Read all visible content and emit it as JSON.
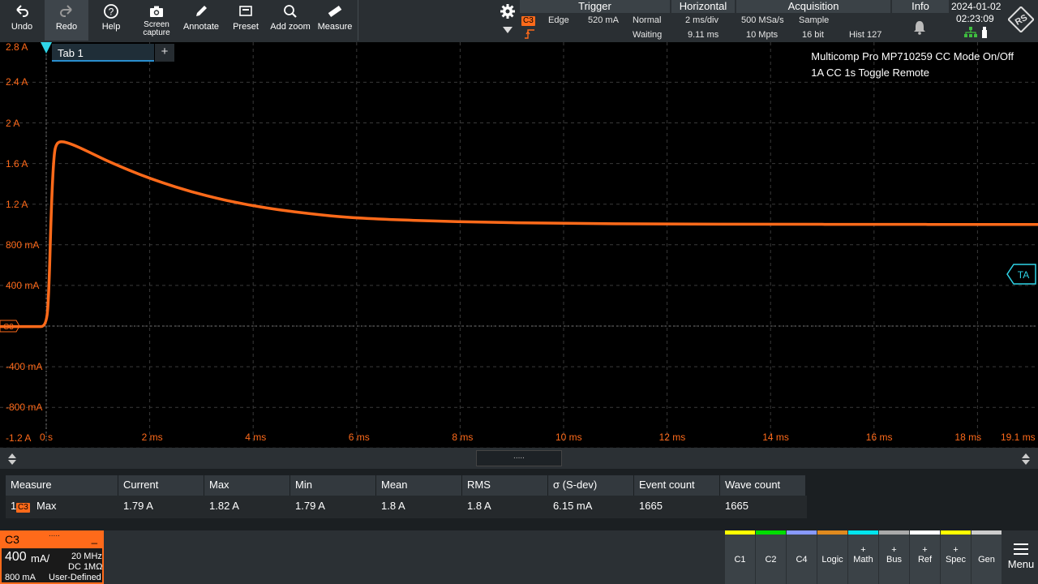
{
  "toolbar": {
    "buttons": [
      {
        "label": "Undo",
        "icon": "undo-icon"
      },
      {
        "label": "Redo",
        "icon": "redo-icon"
      },
      {
        "label": "Help",
        "icon": "help-icon"
      },
      {
        "label": "Screen capture",
        "icon": "camera-icon"
      },
      {
        "label": "Annotate",
        "icon": "pencil-icon"
      },
      {
        "label": "Preset",
        "icon": "preset-icon"
      },
      {
        "label": "Add zoom",
        "icon": "zoom-icon"
      },
      {
        "label": "Measure",
        "icon": "ruler-icon"
      }
    ],
    "screen_capture_line1": "Screen",
    "screen_capture_line2": "capture"
  },
  "trigger": {
    "title": "Trigger",
    "source": "C3",
    "type": "Edge",
    "level": "520 mA",
    "mode": "Normal",
    "state": "Waiting"
  },
  "horizontal": {
    "title": "Horizontal",
    "scale": "2 ms/div",
    "position": "9.11 ms"
  },
  "acquisition": {
    "title": "Acquisition",
    "sample_rate": "500 MSa/s",
    "mode": "Sample",
    "record_length": "10 Mpts",
    "resolution": "16 bit",
    "hist": "Hist 127"
  },
  "info": {
    "title": "Info",
    "date": "2024-01-02",
    "time": "02:23:09"
  },
  "tabs": {
    "tab1": "Tab 1",
    "add": "+"
  },
  "annotation": {
    "line1": "Multicomp Pro MP710259 CC Mode On/Off",
    "line2": "1A CC 1s Toggle Remote"
  },
  "chart_data": {
    "type": "line",
    "series": [
      {
        "name": "C3",
        "color": "#ff6a1a",
        "x_ms": [
          -0.2,
          0,
          0.05,
          0.1,
          0.15,
          0.2,
          0.3,
          0.5,
          0.8,
          1.2,
          2.0,
          3.0,
          4.0,
          5.0,
          6.0,
          8.0,
          10.0,
          12.0,
          14.0,
          16.0,
          18.0,
          19.1
        ],
        "y_A": [
          -0.005,
          -0.005,
          0.3,
          1.2,
          1.7,
          1.8,
          1.82,
          1.79,
          1.72,
          1.62,
          1.45,
          1.29,
          1.18,
          1.11,
          1.06,
          1.025,
          1.01,
          1.004,
          1.002,
          1.001,
          1.0,
          1.0
        ]
      }
    ],
    "y_ticks": [
      "2.8 A",
      "2.4 A",
      "2 A",
      "1.6 A",
      "1.2 A",
      "800 mA",
      "400 mA",
      "",
      "-400 mA",
      "-800 mA",
      "-1.2 A"
    ],
    "y_tick_values": [
      2.8,
      2.4,
      2.0,
      1.6,
      1.2,
      0.8,
      0.4,
      0,
      -0.4,
      -0.8,
      -1.2
    ],
    "x_ticks": [
      "0 s",
      "2 ms",
      "4 ms",
      "6 ms",
      "8 ms",
      "10 ms",
      "12 ms",
      "14 ms",
      "16 ms",
      "18 ms",
      "19.1 ms"
    ],
    "x_tick_values": [
      0,
      2,
      4,
      6,
      8,
      10,
      12,
      14,
      16,
      18,
      19.1
    ],
    "xlim_ms": [
      -0.9,
      19.1
    ],
    "ylim_A": [
      -1.2,
      2.8
    ],
    "grid": true,
    "ground_marker": "C3",
    "trigger_marker": "TA"
  },
  "measurements": {
    "headers": [
      "Measure",
      "Current",
      "Max",
      "Min",
      "Mean",
      "RMS",
      "σ (S-dev)",
      "Event count",
      "Wave count"
    ],
    "rows": [
      {
        "index": "1",
        "source": "C3",
        "name": "Max",
        "current": "1.79 A",
        "max": "1.82 A",
        "min": "1.79 A",
        "mean": "1.8 A",
        "rms": "1.8 A",
        "sdev": "6.15 mA",
        "event_count": "1665",
        "wave_count": "1665"
      }
    ]
  },
  "channel_box": {
    "name": "C3",
    "scale": "400",
    "unit": "mA/",
    "bandwidth": "20 MHz",
    "coupling": "DC 1MΩ",
    "offset": "800 mA",
    "probe": "User-Defined"
  },
  "bottom_buttons": [
    {
      "label": "C1",
      "color": "#ffff00",
      "plus": ""
    },
    {
      "label": "C2",
      "color": "#00dd00",
      "plus": ""
    },
    {
      "label": "C4",
      "color": "#8899ff",
      "plus": ""
    },
    {
      "label": "Logic",
      "color": "#e08a1e",
      "plus": ""
    },
    {
      "label": "Math",
      "color": "#00e5ee",
      "plus": "+"
    },
    {
      "label": "Bus",
      "color": "#aaaaaa",
      "plus": "+"
    },
    {
      "label": "Ref",
      "color": "#ffffff",
      "plus": "+"
    },
    {
      "label": "Spec",
      "color": "#ffff00",
      "plus": "+"
    },
    {
      "label": "Gen",
      "color": "#cccccc",
      "plus": ""
    }
  ],
  "menu_label": "Menu",
  "colors": {
    "channel": "#ff6a1a",
    "grid": "#3a3a3a",
    "trigger": "#2fd5e8",
    "toolbar": "#2a2f33"
  }
}
